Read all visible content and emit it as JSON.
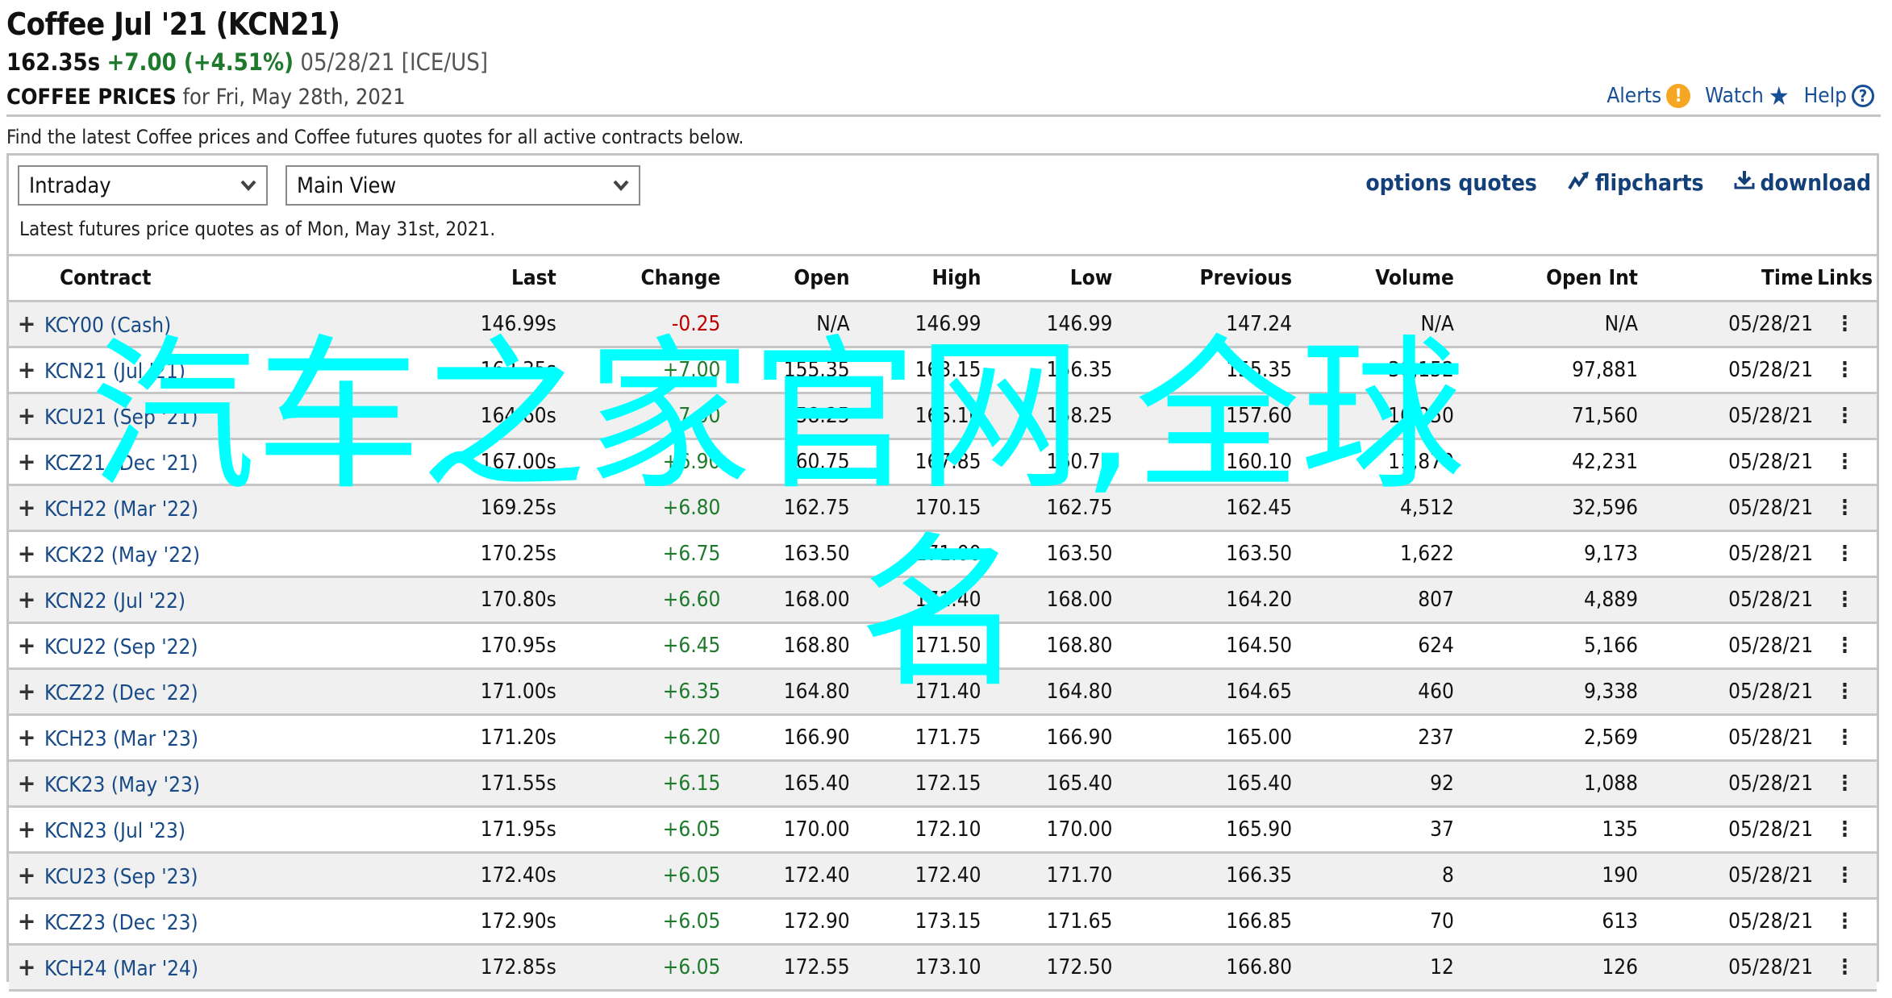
{
  "header": {
    "title": "Coffee Jul '21 (KCN21)",
    "last": "162.35s",
    "change": "+7.00 (+4.51%)",
    "meta": "05/28/21 [ICE/US]",
    "subtitle_bold": "COFFEE PRICES",
    "subtitle_rest": "for Fri, May 28th, 2021",
    "colors": {
      "positive": "#1d7a2a",
      "negative": "#c00000",
      "link": "#174f97",
      "alert": "#f5a623"
    }
  },
  "toplinks": {
    "alerts": "Alerts",
    "alerts_icon": "!",
    "watch": "Watch",
    "watch_icon": "★",
    "help": "Help",
    "help_icon": "?"
  },
  "intro": "Find the latest Coffee prices and Coffee futures quotes for all active contracts below.",
  "controls": {
    "range_select": "Intraday",
    "view_select": "Main View",
    "chevron": "⌄",
    "options_quotes": "options quotes",
    "flipcharts": "flipcharts",
    "download": "download"
  },
  "asof": "Latest futures price quotes as of Mon, May 31st, 2021.",
  "table": {
    "columns": [
      "Contract",
      "Last",
      "Change",
      "Open",
      "High",
      "Low",
      "Previous",
      "Volume",
      "Open Int",
      "Time",
      "Links"
    ],
    "rows": [
      {
        "contract": "KCY00 (Cash)",
        "last": "146.99s",
        "change": "-0.25",
        "open": "N/A",
        "high": "146.99",
        "low": "146.99",
        "previous": "147.24",
        "volume": "N/A",
        "open_int": "N/A",
        "time": "05/28/21",
        "dir": "neg"
      },
      {
        "contract": "KCN21 (Jul '21)",
        "last": "162.35s",
        "change": "+7.00",
        "open": "155.35",
        "high": "163.15",
        "low": "156.35",
        "previous": "155.35",
        "volume": "30,152",
        "open_int": "97,881",
        "time": "05/28/21",
        "dir": "pos"
      },
      {
        "contract": "KCU21 (Sep '21)",
        "last": "164.60s",
        "change": "+7.00",
        "open": "158.25",
        "high": "165.10",
        "low": "158.25",
        "previous": "157.60",
        "volume": "16,250",
        "open_int": "71,560",
        "time": "05/28/21",
        "dir": "pos"
      },
      {
        "contract": "KCZ21 (Dec '21)",
        "last": "167.00s",
        "change": "+6.90",
        "open": "160.75",
        "high": "167.85",
        "low": "160.70",
        "previous": "160.10",
        "volume": "11,870",
        "open_int": "42,231",
        "time": "05/28/21",
        "dir": "pos"
      },
      {
        "contract": "KCH22 (Mar '22)",
        "last": "169.25s",
        "change": "+6.80",
        "open": "162.75",
        "high": "170.15",
        "low": "162.75",
        "previous": "162.45",
        "volume": "4,512",
        "open_int": "32,596",
        "time": "05/28/21",
        "dir": "pos"
      },
      {
        "contract": "KCK22 (May '22)",
        "last": "170.25s",
        "change": "+6.75",
        "open": "163.50",
        "high": "171.00",
        "low": "163.50",
        "previous": "163.50",
        "volume": "1,622",
        "open_int": "9,173",
        "time": "05/28/21",
        "dir": "pos"
      },
      {
        "contract": "KCN22 (Jul '22)",
        "last": "170.80s",
        "change": "+6.60",
        "open": "168.00",
        "high": "171.40",
        "low": "168.00",
        "previous": "164.20",
        "volume": "807",
        "open_int": "4,889",
        "time": "05/28/21",
        "dir": "pos"
      },
      {
        "contract": "KCU22 (Sep '22)",
        "last": "170.95s",
        "change": "+6.45",
        "open": "168.80",
        "high": "171.50",
        "low": "168.80",
        "previous": "164.50",
        "volume": "624",
        "open_int": "5,166",
        "time": "05/28/21",
        "dir": "pos"
      },
      {
        "contract": "KCZ22 (Dec '22)",
        "last": "171.00s",
        "change": "+6.35",
        "open": "164.80",
        "high": "171.40",
        "low": "164.80",
        "previous": "164.65",
        "volume": "460",
        "open_int": "9,338",
        "time": "05/28/21",
        "dir": "pos"
      },
      {
        "contract": "KCH23 (Mar '23)",
        "last": "171.20s",
        "change": "+6.20",
        "open": "166.90",
        "high": "171.75",
        "low": "166.90",
        "previous": "165.00",
        "volume": "237",
        "open_int": "2,569",
        "time": "05/28/21",
        "dir": "pos"
      },
      {
        "contract": "KCK23 (May '23)",
        "last": "171.55s",
        "change": "+6.15",
        "open": "165.40",
        "high": "172.15",
        "low": "165.40",
        "previous": "165.40",
        "volume": "92",
        "open_int": "1,088",
        "time": "05/28/21",
        "dir": "pos"
      },
      {
        "contract": "KCN23 (Jul '23)",
        "last": "171.95s",
        "change": "+6.05",
        "open": "170.00",
        "high": "172.10",
        "low": "170.00",
        "previous": "165.90",
        "volume": "37",
        "open_int": "135",
        "time": "05/28/21",
        "dir": "pos"
      },
      {
        "contract": "KCU23 (Sep '23)",
        "last": "172.40s",
        "change": "+6.05",
        "open": "172.40",
        "high": "172.40",
        "low": "171.70",
        "previous": "166.35",
        "volume": "8",
        "open_int": "190",
        "time": "05/28/21",
        "dir": "pos"
      },
      {
        "contract": "KCZ23 (Dec '23)",
        "last": "172.90s",
        "change": "+6.05",
        "open": "172.90",
        "high": "173.15",
        "low": "171.65",
        "previous": "166.85",
        "volume": "70",
        "open_int": "613",
        "time": "05/28/21",
        "dir": "pos"
      },
      {
        "contract": "KCH24 (Mar '24)",
        "last": "172.85s",
        "change": "+6.05",
        "open": "172.55",
        "high": "173.10",
        "low": "172.50",
        "previous": "166.80",
        "volume": "12",
        "open_int": "126",
        "time": "05/28/21",
        "dir": "pos"
      }
    ],
    "expand_icon": "+",
    "links_icon": "⋮"
  },
  "watermark": {
    "line1": "汽车之家官网,全球",
    "line2": "名",
    "color": "#00ffff"
  }
}
